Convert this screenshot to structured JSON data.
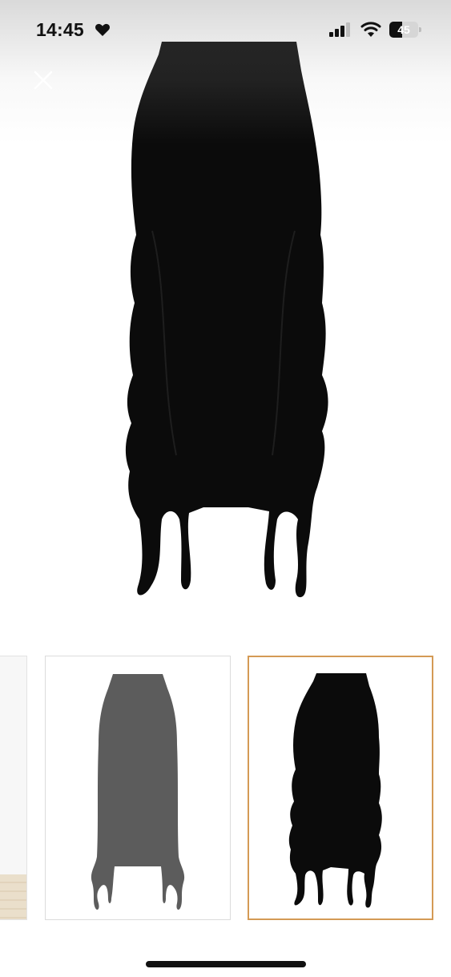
{
  "status_bar": {
    "time": "14:45",
    "battery_level": "45",
    "battery_fraction": 0.45
  },
  "icons": {
    "heart": "heart-icon",
    "signal": "cellular-signal-icon",
    "wifi": "wifi-icon",
    "close": "close-icon"
  },
  "gallery": {
    "selected_index": 2,
    "thumbnails": [
      "partial-thumbnail",
      "grey-skirt-thumbnail",
      "black-skirt-thumbnail"
    ]
  },
  "colors": {
    "accent_selected_border": "#d49a55",
    "product_black": "#0b0b0b",
    "product_grey": "#5c5c5c"
  }
}
